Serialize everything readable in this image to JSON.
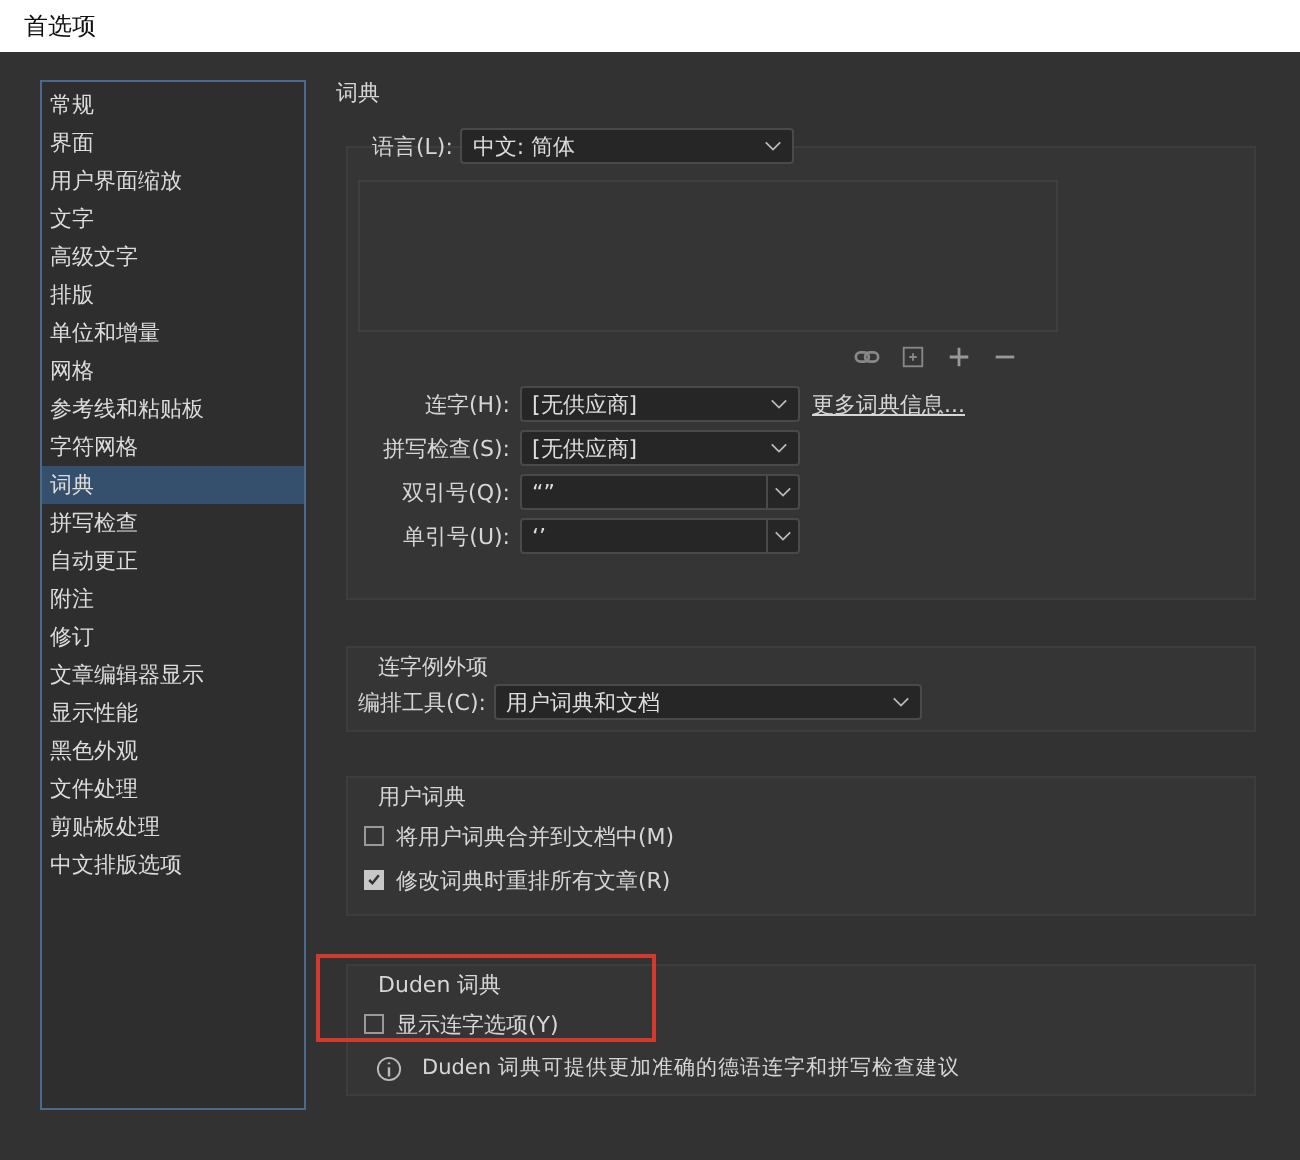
{
  "window": {
    "title": "首选项"
  },
  "sidebar": {
    "items": [
      {
        "label": "常规",
        "selected": false
      },
      {
        "label": "界面",
        "selected": false
      },
      {
        "label": "用户界面缩放",
        "selected": false
      },
      {
        "label": "文字",
        "selected": false
      },
      {
        "label": "高级文字",
        "selected": false
      },
      {
        "label": "排版",
        "selected": false
      },
      {
        "label": "单位和增量",
        "selected": false
      },
      {
        "label": "网格",
        "selected": false
      },
      {
        "label": "参考线和粘贴板",
        "selected": false
      },
      {
        "label": "字符网格",
        "selected": false
      },
      {
        "label": "词典",
        "selected": true
      },
      {
        "label": "拼写检查",
        "selected": false
      },
      {
        "label": "自动更正",
        "selected": false
      },
      {
        "label": "附注",
        "selected": false
      },
      {
        "label": "修订",
        "selected": false
      },
      {
        "label": "文章编辑器显示",
        "selected": false
      },
      {
        "label": "显示性能",
        "selected": false
      },
      {
        "label": "黑色外观",
        "selected": false
      },
      {
        "label": "文件处理",
        "selected": false
      },
      {
        "label": "剪贴板处理",
        "selected": false
      },
      {
        "label": "中文排版选项",
        "selected": false
      }
    ]
  },
  "panel": {
    "title": "词典",
    "language": {
      "label": "语言(L):",
      "value": "中文: 简体"
    },
    "fields": [
      {
        "label": "连字(H):",
        "value": "[无供应商]",
        "kind": "select"
      },
      {
        "label": "拼写检查(S):",
        "value": "[无供应商]",
        "kind": "select"
      },
      {
        "label": "双引号(Q):",
        "value": "“”",
        "kind": "combo"
      },
      {
        "label": "单引号(U):",
        "value": "‘’",
        "kind": "combo"
      }
    ],
    "more_link": "更多词典信息...",
    "exceptions": {
      "title": "连字例外项",
      "label": "编排工具(C):",
      "value": "用户词典和文档"
    },
    "user_dictionary": {
      "title": "用户词典",
      "options": [
        {
          "label": "将用户词典合并到文档中(M)",
          "checked": false
        },
        {
          "label": "修改词典时重排所有文章(R)",
          "checked": true
        }
      ]
    },
    "duden": {
      "title": "Duden 词典",
      "highlighted": true,
      "options": [
        {
          "label": "显示连字选项(Y)",
          "checked": false
        }
      ],
      "info": "Duden 词典可提供更加准确的德语连字和拼写检查建议"
    }
  }
}
